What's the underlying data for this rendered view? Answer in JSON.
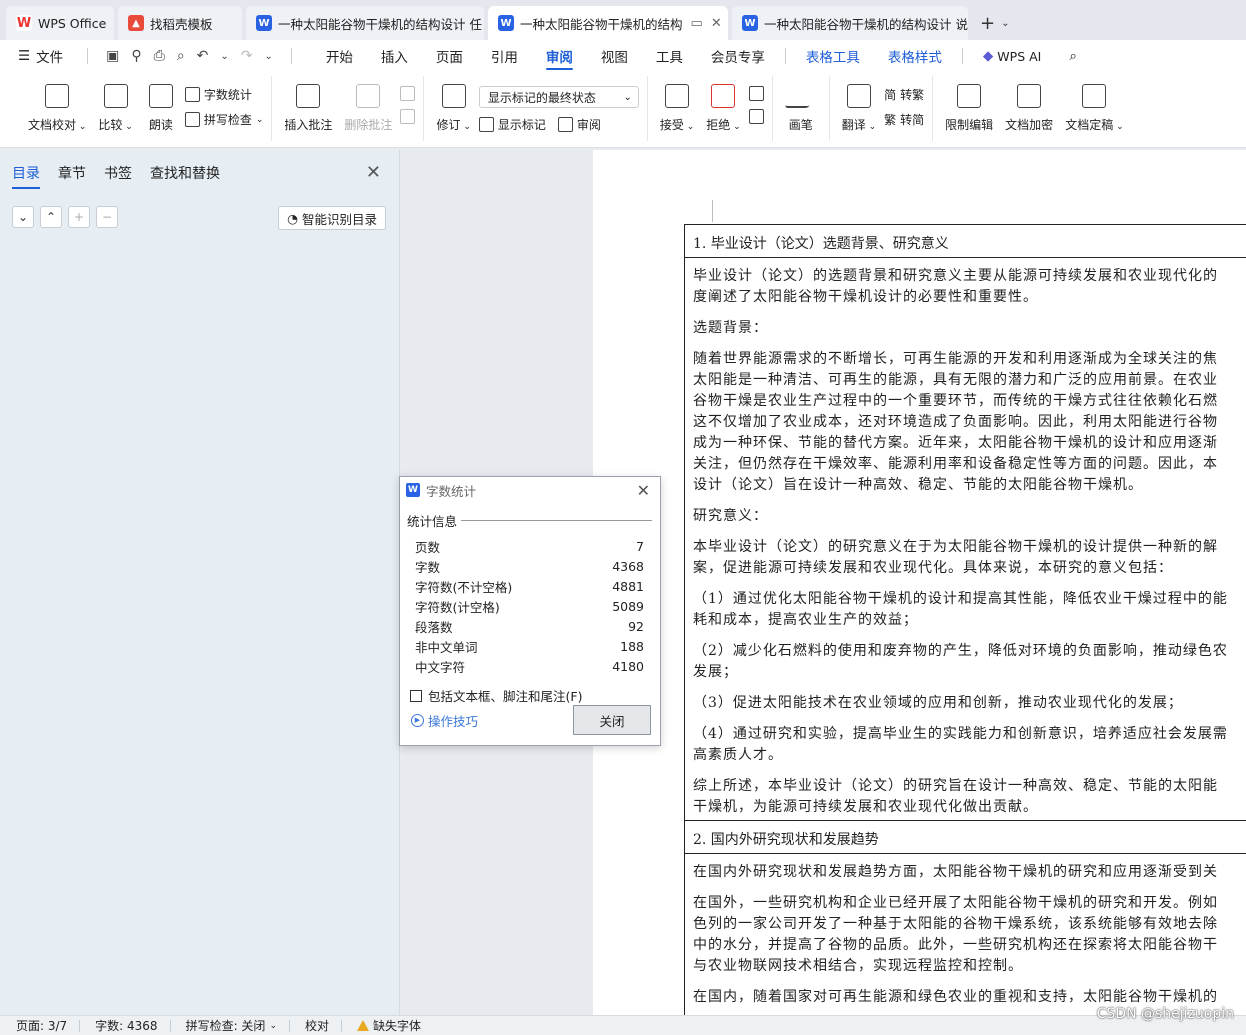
{
  "tabs": [
    {
      "icon": "wps-logo-icon",
      "label": "WPS Office",
      "active": false
    },
    {
      "icon": "template-icon",
      "label": "找稻壳模板",
      "active": false
    },
    {
      "icon": "word-doc-icon",
      "label": "一种太阳能谷物干燥机的结构设计 任",
      "active": false
    },
    {
      "icon": "word-doc-icon",
      "label": "一种太阳能谷物干燥机的结构",
      "active": true
    },
    {
      "icon": "word-doc-icon",
      "label": "一种太阳能谷物干燥机的结构设计 说",
      "active": false
    }
  ],
  "menu": {
    "file": "文件",
    "items": [
      "开始",
      "插入",
      "页面",
      "引用",
      "审阅",
      "视图",
      "工具",
      "会员专享"
    ],
    "active": "审阅",
    "context_items": [
      "表格工具",
      "表格样式"
    ],
    "wps_ai": "WPS AI"
  },
  "ribbon": {
    "doc_check": "文档校对",
    "compare": "比较",
    "read_aloud": "朗读",
    "word_count": "字数统计",
    "spell_check": "拼写检查",
    "insert_comment": "插入批注",
    "delete_comment": "删除批注",
    "revise": "修订",
    "markup_select": "显示标记的最终状态",
    "show_markup": "显示标记",
    "review": "审阅",
    "accept": "接受",
    "reject": "拒绝",
    "ink": "画笔",
    "translate": "翻译",
    "to_traditional": "转繁",
    "to_simplified": "转简",
    "restrict_edit": "限制编辑",
    "encrypt": "文档加密",
    "finalize": "文档定稿"
  },
  "nav": {
    "tabs": [
      "目录",
      "章节",
      "书签",
      "查找和替换"
    ],
    "active": "目录",
    "smart_toc": "智能识别目录"
  },
  "document": {
    "heading1": "1. 毕业设计（论文）选题背景、研究意义",
    "paragraphs": [
      "毕业设计（论文）的选题背景和研究意义主要从能源可持续发展和农业现代化的",
      "度阐述了太阳能谷物干燥机设计的必要性和重要性。",
      "选题背景：",
      "随着世界能源需求的不断增长，可再生能源的开发和利用逐渐成为全球关注的焦",
      "太阳能是一种清洁、可再生的能源，具有无限的潜力和广泛的应用前景。在农业",
      "谷物干燥是农业生产过程中的一个重要环节，而传统的干燥方式往往依赖化石燃",
      "这不仅增加了农业成本，还对环境造成了负面影响。因此，利用太阳能进行谷物",
      "成为一种环保、节能的替代方案。近年来，太阳能谷物干燥机的设计和应用逐渐",
      "关注，但仍然存在干燥效率、能源利用率和设备稳定性等方面的问题。因此，本",
      "设计（论文）旨在设计一种高效、稳定、节能的太阳能谷物干燥机。",
      "研究意义：",
      "本毕业设计（论文）的研究意义在于为太阳能谷物干燥机的设计提供一种新的解",
      "案，促进能源可持续发展和农业现代化。具体来说，本研究的意义包括：",
      "（1）通过优化太阳能谷物干燥机的设计和提高其性能，降低农业干燥过程中的能",
      "耗和成本，提高农业生产的效益；",
      "（2）减少化石燃料的使用和废弃物的产生，降低对环境的负面影响，推动绿色农",
      "发展；",
      "（3）促进太阳能技术在农业领域的应用和创新，推动农业现代化的发展；",
      "（4）通过研究和实验，提高毕业生的实践能力和创新意识，培养适应社会发展需",
      "高素质人才。",
      "综上所述，本毕业设计（论文）的研究旨在设计一种高效、稳定、节能的太阳能",
      "干燥机，为能源可持续发展和农业现代化做出贡献。"
    ],
    "heading2": "2. 国内外研究现状和发展趋势",
    "paragraphs2": [
      "在国内外研究现状和发展趋势方面，太阳能谷物干燥机的研究和应用逐渐受到关",
      "在国外，一些研究机构和企业已经开展了太阳能谷物干燥机的研究和开发。例如",
      "色列的一家公司开发了一种基于太阳能的谷物干燥系统，该系统能够有效地去除",
      "中的水分，并提高了谷物的品质。此外，一些研究机构还在探索将太阳能谷物干",
      "与农业物联网技术相结合，实现远程监控和控制。",
      "在国内，随着国家对可再生能源和绿色农业的重视和支持，太阳能谷物干燥机的"
    ]
  },
  "dialog": {
    "title": "字数统计",
    "section": "统计信息",
    "rows": [
      {
        "label": "页数",
        "value": "7"
      },
      {
        "label": "字数",
        "value": "4368"
      },
      {
        "label": "字符数(不计空格)",
        "value": "4881"
      },
      {
        "label": "字符数(计空格)",
        "value": "5089"
      },
      {
        "label": "段落数",
        "value": "92"
      },
      {
        "label": "非中文单词",
        "value": "188"
      },
      {
        "label": "中文字符",
        "value": "4180"
      }
    ],
    "include_label": "包括文本框、脚注和尾注(F)",
    "include_checked": false,
    "tips": "操作技巧",
    "close": "关闭"
  },
  "status": {
    "page": "页面: 3/7",
    "words": "字数: 4368",
    "spell": "拼写检查: 关闭",
    "proof": "校对",
    "missing_font": "缺失字体"
  },
  "watermark": "CSDN @shejizuopin"
}
